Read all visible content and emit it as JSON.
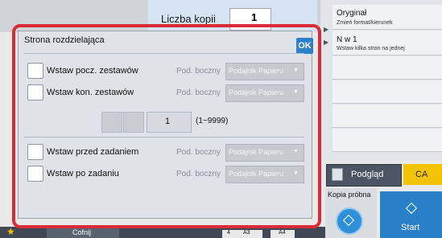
{
  "background": {
    "copies_label": "Liczba kopii",
    "copies_value": "1",
    "right_panel": [
      {
        "title": "Oryginał",
        "subtitle": "Zmień format/kierunek"
      },
      {
        "title": "N w 1",
        "subtitle": "Wstaw kilka stron na jednej"
      }
    ],
    "preview_label": "Podgląd",
    "ca_label": "CA",
    "trial_label": "Kopia próbna",
    "start_label": "Start",
    "bottom_label": "Cofnij",
    "bottom_trays": [
      "4",
      "A3",
      "A4"
    ]
  },
  "dialog": {
    "title": "Strona rozdzielająca",
    "ok_label": "OK",
    "rows": [
      {
        "label": "Wstaw pocz. zestawów",
        "side": "Pod. boczny",
        "tray": "Podajnik Papieru",
        "checked": false
      },
      {
        "label": "Wstaw kon. zestawów",
        "side": "Pod. boczny",
        "tray": "Podajnik Papieru",
        "checked": false
      },
      {
        "label": "Wstaw przed zadaniem",
        "side": "Pod. boczny",
        "tray": "Podajnik Papieru",
        "checked": false
      },
      {
        "label": "Wstaw po zadaniu",
        "side": "Pod. boczny",
        "tray": "Podajnik Papieru",
        "checked": false
      }
    ],
    "quantity": {
      "value": "1",
      "range": "(1~9999)"
    }
  },
  "colors": {
    "highlight_frame": "#dc2b38",
    "ok_button": "#2e7fcc",
    "ca_button": "#f5c400",
    "start_button": "#2a7fc9"
  }
}
